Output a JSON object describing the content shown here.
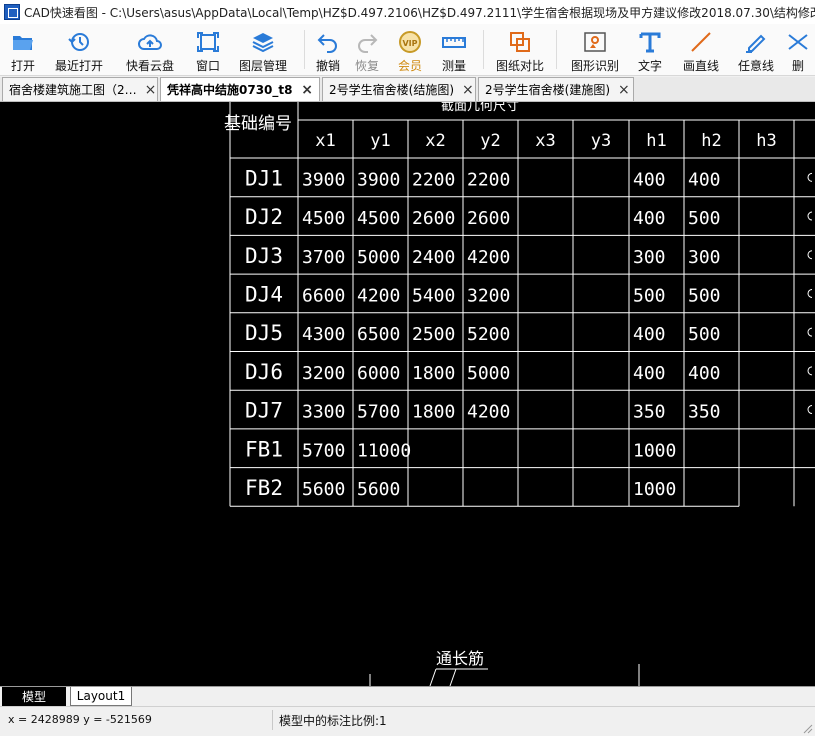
{
  "window": {
    "title": "CAD快速看图 - C:\\Users\\asus\\AppData\\Local\\Temp\\HZ$D.497.2106\\HZ$D.497.2111\\学生宿舍根据现场及甲方建议修改2018.07.30\\结构修改\\凭",
    "app_icon": "cad-app-icon"
  },
  "toolbar": {
    "items": [
      {
        "label": "打开",
        "icon": "folder-open-icon",
        "enabled": true
      },
      {
        "label": "最近打开",
        "icon": "history-icon",
        "enabled": true
      },
      {
        "label": "快看云盘",
        "icon": "cloud-icon",
        "enabled": true
      },
      {
        "label": "窗口",
        "icon": "window-icon",
        "enabled": true
      },
      {
        "label": "图层管理",
        "icon": "layers-icon",
        "enabled": true
      },
      {
        "label": "撤销",
        "icon": "undo-icon",
        "enabled": true
      },
      {
        "label": "恢复",
        "icon": "redo-icon",
        "enabled": false
      },
      {
        "label": "会员",
        "icon": "vip-icon",
        "enabled": true,
        "badge": "VIP"
      },
      {
        "label": "测量",
        "icon": "ruler-icon",
        "enabled": true
      },
      {
        "label": "图纸对比",
        "icon": "compare-icon",
        "enabled": true
      },
      {
        "label": "图形识别",
        "icon": "shape-recognize-icon",
        "enabled": true
      },
      {
        "label": "文字",
        "icon": "text-icon",
        "enabled": true
      },
      {
        "label": "画直线",
        "icon": "line-icon",
        "enabled": true
      },
      {
        "label": "任意线",
        "icon": "pen-icon",
        "enabled": true
      },
      {
        "label": "删",
        "icon": "delete-icon",
        "enabled": true
      }
    ]
  },
  "tabs": [
    {
      "label": "宿舍楼建筑施工图（2…",
      "active": false
    },
    {
      "label": "凭祥高中结施0730_t8",
      "active": true
    },
    {
      "label": "2号学生宿舍楼(结施图)",
      "active": false
    },
    {
      "label": "2号学生宿舍楼(建施图)",
      "active": false
    }
  ],
  "drawing": {
    "table": {
      "top_header": "截面几何尺寸",
      "corner_header": "基础编号",
      "columns": [
        "x1",
        "y1",
        "x2",
        "y2",
        "x3",
        "y3",
        "h1",
        "h2",
        "h3"
      ],
      "rows": [
        {
          "id": "DJ1",
          "cells": [
            "3900",
            "3900",
            "2200",
            "2200",
            "",
            "",
            "400",
            "400",
            ""
          ]
        },
        {
          "id": "DJ2",
          "cells": [
            "4500",
            "4500",
            "2600",
            "2600",
            "",
            "",
            "400",
            "500",
            ""
          ]
        },
        {
          "id": "DJ3",
          "cells": [
            "3700",
            "5000",
            "2400",
            "4200",
            "",
            "",
            "300",
            "300",
            ""
          ]
        },
        {
          "id": "DJ4",
          "cells": [
            "6600",
            "4200",
            "5400",
            "3200",
            "",
            "",
            "500",
            "500",
            ""
          ]
        },
        {
          "id": "DJ5",
          "cells": [
            "4300",
            "6500",
            "2500",
            "5200",
            "",
            "",
            "400",
            "500",
            ""
          ]
        },
        {
          "id": "DJ6",
          "cells": [
            "3200",
            "6000",
            "1800",
            "5000",
            "",
            "",
            "400",
            "400",
            ""
          ]
        },
        {
          "id": "DJ7",
          "cells": [
            "3300",
            "5700",
            "1800",
            "4200",
            "",
            "",
            "350",
            "350",
            ""
          ]
        },
        {
          "id": "FB1",
          "cells": [
            "5700",
            "11000",
            "",
            "",
            "",
            "",
            "1000",
            "",
            ""
          ]
        },
        {
          "id": "FB2",
          "cells": [
            "5600",
            "5600",
            "",
            "",
            "",
            "",
            "1000",
            "",
            ""
          ]
        }
      ]
    },
    "annotation": "通长筋"
  },
  "layout_tabs": [
    {
      "label": "模型",
      "active": true
    },
    {
      "label": "Layout1",
      "active": false
    }
  ],
  "status": {
    "coordinates": "x = 2428989  y = -521569",
    "scale_text": "模型中的标注比例:1"
  }
}
